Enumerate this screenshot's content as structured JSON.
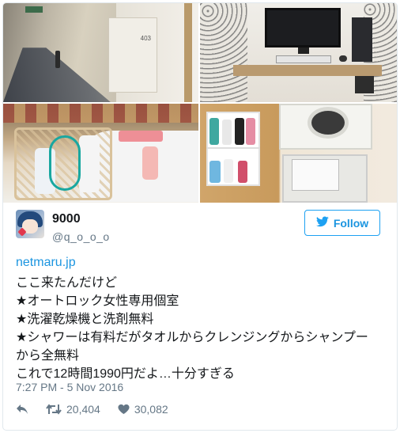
{
  "tweet": {
    "display_name": "9000",
    "handle": "@q_o_o_o",
    "follow_label": "Follow",
    "link": "netmaru.jp",
    "lines": [
      "ここ来たんだけど",
      "★オートロック女性専用個室",
      "★洗濯乾燥機と洗剤無料",
      "★シャワーは有料だがタオルからクレンジングからシャンプー",
      "から全無料",
      "これで12時間1990円だよ…十分すぎる"
    ],
    "timestamp": "7:27 PM - 5 Nov 2016",
    "retweets": "20,404",
    "likes": "30,082"
  },
  "photos": [
    {
      "name": "hallway",
      "door_number": "403"
    },
    {
      "name": "desk-booth"
    },
    {
      "name": "sink-toiletries"
    },
    {
      "name": "laundry-machines"
    }
  ],
  "colors": {
    "accent": "#1da1f2",
    "link": "#1b95e0",
    "muted": "#657786",
    "text": "#14171a",
    "border": "#e1e8ed"
  },
  "icons": {
    "follow": "twitter-bird-icon",
    "reply": "reply-icon",
    "retweet": "retweet-icon",
    "like": "heart-icon"
  }
}
